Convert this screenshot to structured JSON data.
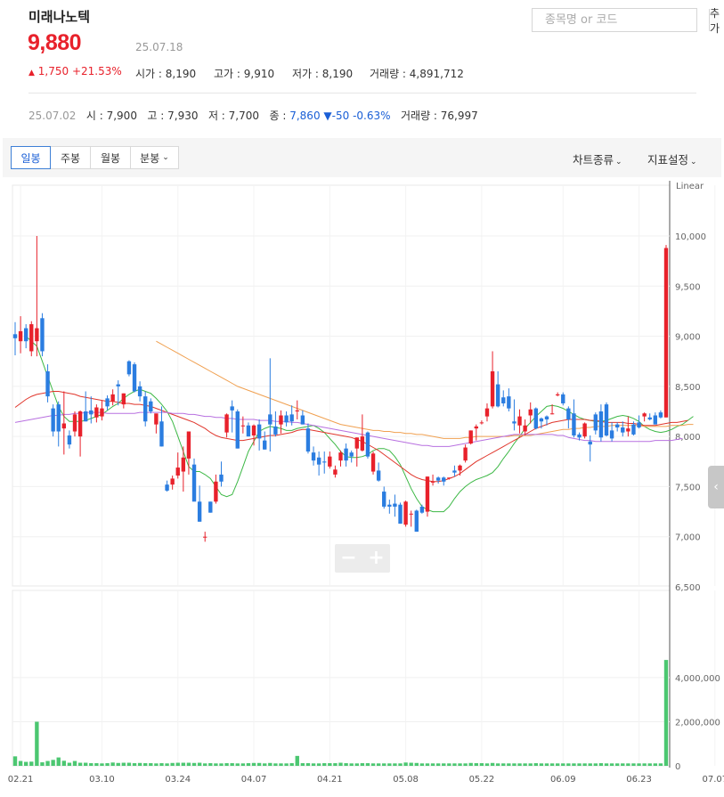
{
  "header": {
    "stock_name": "미래나노텍",
    "search_placeholder": "종목명 or 코드",
    "add_label": "추가",
    "price": "9,880",
    "date": "25.07.18",
    "change_arrow": "▲",
    "change_value": "1,750",
    "change_pct": "+21.53%",
    "open": "시가 : 8,190",
    "high": "고가 : 9,910",
    "low": "저가 : 8,190",
    "volume": "거래량 : 4,891,712"
  },
  "prev": {
    "date": "25.07.02",
    "open": "시 : 7,900",
    "high": "고 : 7,930",
    "low": "저 : 7,700",
    "close_label": "종 :",
    "close_value": "7,860",
    "change_arrow": "▼",
    "change_value": "-50",
    "change_pct": "-0.63%",
    "volume": "거래량 : 76,997"
  },
  "toolbar": {
    "periods": [
      "일봉",
      "주봉",
      "월봉",
      "분봉"
    ],
    "active_period": "일봉",
    "chart_type": "차트종류",
    "indicator": "지표설정"
  },
  "colors": {
    "up": "#e8212b",
    "down": "#2b7de0",
    "volume": "#4cc771",
    "ma5": "#3cb845",
    "ma20": "#e0352b",
    "ma60": "#f0a050",
    "ma120": "#b870e0"
  },
  "chart_data": {
    "type": "candlestick",
    "scale_label": "Linear",
    "y_ticks": [
      "10,000",
      "9,500",
      "9,000",
      "8,500",
      "8,000",
      "7,500",
      "7,000",
      "6,500"
    ],
    "ylim": [
      6500,
      10500
    ],
    "volume_ticks": [
      "4,000,000",
      "2,000,000",
      "0"
    ],
    "volume_ylim": [
      0,
      6500000
    ],
    "x_labels": [
      "02.21",
      "03.10",
      "03.24",
      "04.07",
      "04.21",
      "05.08",
      "05.22",
      "06.09",
      "06.23",
      "07.07"
    ],
    "candles": [
      [
        9020,
        9140,
        8810,
        8980
      ],
      [
        8950,
        9200,
        8830,
        9050
      ],
      [
        9080,
        9120,
        8880,
        8950
      ],
      [
        8850,
        9150,
        8800,
        9120
      ],
      [
        8950,
        10000,
        8800,
        9080
      ],
      [
        9180,
        9230,
        8800,
        8850
      ],
      [
        8650,
        8720,
        8340,
        8400
      ],
      [
        8280,
        8320,
        8000,
        8050
      ],
      [
        8320,
        8350,
        7900,
        8050
      ],
      [
        8080,
        8450,
        7820,
        8130
      ],
      [
        8010,
        8060,
        7880,
        7920
      ],
      [
        8050,
        8250,
        8000,
        8220
      ],
      [
        8000,
        8260,
        7800,
        8250
      ],
      [
        8250,
        8450,
        8150,
        8150
      ],
      [
        8260,
        8400,
        8130,
        8220
      ],
      [
        8190,
        8320,
        8140,
        8290
      ],
      [
        8200,
        8360,
        8160,
        8280
      ],
      [
        8380,
        8410,
        8260,
        8300
      ],
      [
        8350,
        8470,
        8310,
        8420
      ],
      [
        8520,
        8560,
        8310,
        8500
      ],
      [
        8320,
        8430,
        8280,
        8430
      ],
      [
        8750,
        8760,
        8600,
        8620
      ],
      [
        8720,
        8740,
        8440,
        8450
      ],
      [
        8500,
        8550,
        8350,
        8400
      ],
      [
        8400,
        8450,
        8100,
        8150
      ],
      [
        8350,
        8380,
        8230,
        8250
      ],
      [
        8120,
        8220,
        8030,
        8230
      ],
      [
        8150,
        8300,
        7900,
        7900
      ],
      [
        7520,
        7560,
        7450,
        7460
      ],
      [
        7520,
        7610,
        7470,
        7580
      ],
      [
        7610,
        7840,
        7580,
        7690
      ],
      [
        7650,
        7900,
        7450,
        7790
      ],
      [
        7780,
        8050,
        7620,
        8050
      ],
      [
        7720,
        7780,
        7360,
        7350
      ],
      [
        7350,
        7510,
        7150,
        7150
      ],
      [
        7000,
        7050,
        6950,
        7000
      ],
      [
        7350,
        7350,
        7240,
        7240
      ],
      [
        7350,
        7620,
        7330,
        7550
      ],
      [
        7620,
        7750,
        7500,
        7550
      ],
      [
        8040,
        8230,
        7990,
        8220
      ],
      [
        8300,
        8360,
        8040,
        8260
      ],
      [
        8250,
        8270,
        7880,
        7880
      ],
      [
        8110,
        8200,
        8030,
        8110
      ],
      [
        8110,
        8140,
        8000,
        8000
      ],
      [
        8010,
        8120,
        7910,
        8110
      ],
      [
        8120,
        8170,
        7860,
        7980
      ],
      [
        7960,
        8050,
        7870,
        7870
      ],
      [
        8220,
        8780,
        7850,
        8120
      ],
      [
        8100,
        8250,
        8000,
        8020
      ],
      [
        8120,
        8260,
        8030,
        8210
      ],
      [
        8210,
        8250,
        8100,
        8140
      ],
      [
        8220,
        8310,
        8110,
        8150
      ],
      [
        8250,
        8360,
        8170,
        8260
      ],
      [
        8210,
        8260,
        8120,
        8120
      ],
      [
        8080,
        8130,
        7830,
        7850
      ],
      [
        7840,
        7900,
        7710,
        7760
      ],
      [
        7790,
        7850,
        7610,
        7720
      ],
      [
        7750,
        7850,
        7630,
        7740
      ],
      [
        7700,
        7850,
        7680,
        7800
      ],
      [
        7620,
        7710,
        7590,
        7670
      ],
      [
        7760,
        7860,
        7700,
        7840
      ],
      [
        7880,
        7930,
        7700,
        7760
      ],
      [
        7840,
        7860,
        7740,
        7800
      ],
      [
        7880,
        7990,
        7700,
        7990
      ],
      [
        7860,
        8220,
        7850,
        8000
      ],
      [
        8040,
        8050,
        7780,
        7800
      ],
      [
        7650,
        7850,
        7620,
        7830
      ],
      [
        7660,
        7740,
        7550,
        7560
      ],
      [
        7450,
        7500,
        7280,
        7300
      ],
      [
        7320,
        7370,
        7230,
        7300
      ],
      [
        7330,
        7420,
        7200,
        7300
      ],
      [
        7320,
        7340,
        7130,
        7130
      ],
      [
        7120,
        7360,
        7100,
        7350
      ],
      [
        7230,
        7260,
        7100,
        7230
      ],
      [
        7260,
        7270,
        7050,
        7050
      ],
      [
        7300,
        7320,
        7230,
        7240
      ],
      [
        7250,
        7600,
        7200,
        7600
      ],
      [
        7540,
        7620,
        7510,
        7550
      ],
      [
        7590,
        7600,
        7530,
        7560
      ],
      [
        7590,
        7600,
        7510,
        7550
      ],
      [
        7580,
        7590,
        7570,
        7590
      ],
      [
        7660,
        7710,
        7600,
        7640
      ],
      [
        7660,
        7720,
        7610,
        7710
      ],
      [
        7760,
        7920,
        7740,
        7890
      ],
      [
        7930,
        8060,
        7920,
        8060
      ],
      [
        8080,
        8120,
        7960,
        8100
      ],
      [
        8140,
        8160,
        8120,
        8140
      ],
      [
        8200,
        8330,
        8150,
        8280
      ],
      [
        8300,
        8850,
        8280,
        8650
      ],
      [
        8520,
        8650,
        8290,
        8300
      ],
      [
        8390,
        8460,
        8300,
        8330
      ],
      [
        8400,
        8480,
        8250,
        8280
      ],
      [
        8150,
        8370,
        8060,
        8130
      ],
      [
        8110,
        8270,
        8030,
        8200
      ],
      [
        8050,
        8170,
        8010,
        8110
      ],
      [
        8210,
        8340,
        8130,
        8270
      ],
      [
        8280,
        8290,
        8070,
        8080
      ],
      [
        8180,
        8190,
        8080,
        8150
      ],
      [
        8200,
        8210,
        8110,
        8170
      ],
      [
        8230,
        8320,
        8220,
        8230
      ],
      [
        8410,
        8440,
        8400,
        8420
      ],
      [
        8420,
        8440,
        8310,
        8330
      ],
      [
        8280,
        8300,
        8080,
        8170
      ],
      [
        8230,
        8370,
        7990,
        8010
      ],
      [
        8020,
        8040,
        7960,
        7990
      ],
      [
        8000,
        8140,
        7980,
        8130
      ],
      [
        7950,
        8010,
        7750,
        7920
      ],
      [
        8220,
        8240,
        8020,
        8060
      ],
      [
        8250,
        8320,
        7950,
        7990
      ],
      [
        8320,
        8340,
        8000,
        8010
      ],
      [
        8060,
        8140,
        7950,
        7980
      ],
      [
        8120,
        8140,
        8050,
        8090
      ],
      [
        8090,
        8150,
        8000,
        8040
      ],
      [
        8050,
        8200,
        8000,
        8080
      ],
      [
        8120,
        8150,
        8010,
        8020
      ],
      [
        8140,
        8210,
        8080,
        8090
      ],
      [
        8200,
        8240,
        8150,
        8230
      ],
      [
        8190,
        8230,
        8160,
        8170
      ],
      [
        8210,
        8240,
        8120,
        8120
      ],
      [
        8240,
        8260,
        8180,
        8190
      ],
      [
        8190,
        9910,
        8190,
        9880
      ]
    ],
    "volume": [
      430000,
      220000,
      180000,
      190000,
      2000000,
      160000,
      220000,
      270000,
      380000,
      230000,
      140000,
      220000,
      140000,
      140000,
      120000,
      120000,
      110000,
      120000,
      150000,
      130000,
      140000,
      140000,
      120000,
      130000,
      120000,
      120000,
      110000,
      120000,
      110000,
      130000,
      140000,
      140000,
      140000,
      130000,
      140000,
      110000,
      120000,
      110000,
      110000,
      120000,
      120000,
      110000,
      110000,
      120000,
      130000,
      130000,
      110000,
      130000,
      110000,
      110000,
      110000,
      120000,
      450000,
      120000,
      120000,
      110000,
      110000,
      120000,
      120000,
      120000,
      140000,
      120000,
      110000,
      110000,
      120000,
      120000,
      110000,
      110000,
      110000,
      110000,
      110000,
      110000,
      150000,
      140000,
      130000,
      110000,
      110000,
      110000,
      110000,
      110000,
      110000,
      110000,
      110000,
      110000,
      130000,
      120000,
      120000,
      110000,
      130000,
      110000,
      110000,
      110000,
      110000,
      110000,
      110000,
      110000,
      120000,
      110000,
      110000,
      110000,
      110000,
      110000,
      110000,
      110000,
      110000,
      110000,
      110000,
      110000,
      120000,
      110000,
      110000,
      110000,
      110000,
      110000,
      110000,
      110000,
      110000,
      110000,
      110000,
      110000,
      4800000
    ],
    "ma_lines": [
      {
        "key": "ma5",
        "start": 2,
        "values": [
          9000,
          8950,
          8900,
          8750,
          8600,
          8450,
          8300,
          8200,
          8150,
          8150,
          8150,
          8160,
          8180,
          8200,
          8220,
          8260,
          8300,
          8330,
          8380,
          8420,
          8450,
          8470,
          8450,
          8430,
          8380,
          8320,
          8250,
          8150,
          8000,
          7850,
          7700,
          7650,
          7650,
          7620,
          7580,
          7500,
          7420,
          7400,
          7420,
          7550,
          7700,
          7850,
          7950,
          8050,
          8080,
          8100,
          8090,
          8080,
          8060,
          8060,
          8080,
          8090,
          8100,
          8110,
          8080,
          8040,
          7980,
          7920,
          7850,
          7800,
          7790,
          7790,
          7800,
          7820,
          7860,
          7880,
          7880,
          7860,
          7800,
          7720,
          7600,
          7480,
          7380,
          7300,
          7270,
          7250,
          7250,
          7250,
          7300,
          7380,
          7450,
          7500,
          7540,
          7570,
          7590,
          7610,
          7640,
          7700,
          7780,
          7850,
          7930,
          8000,
          8080,
          8140,
          8200,
          8250,
          8300,
          8310,
          8300,
          8280,
          8250,
          8220,
          8190,
          8170,
          8160,
          8150,
          8150,
          8160,
          8180,
          8200,
          8210,
          8200,
          8180,
          8150,
          8100,
          8070,
          8050,
          8040,
          8050,
          8070,
          8100,
          8120,
          8160,
          8200
        ]
      },
      {
        "key": "ma20",
        "start": 0,
        "values": [
          8290,
          8330,
          8370,
          8400,
          8420,
          8430,
          8440,
          8450,
          8450,
          8440,
          8430,
          8420,
          8400,
          8390,
          8380,
          8370,
          8360,
          8350,
          8350,
          8340,
          8330,
          8330,
          8320,
          8320,
          8310,
          8300,
          8280,
          8260,
          8240,
          8220,
          8200,
          8180,
          8160,
          8140,
          8110,
          8080,
          8040,
          8010,
          7990,
          7980,
          7970,
          7960,
          7960,
          7970,
          7980,
          7990,
          8000,
          8010,
          8010,
          8020,
          8030,
          8040,
          8060,
          8070,
          8070,
          8060,
          8050,
          8040,
          8030,
          8020,
          8010,
          8000,
          7990,
          7970,
          7950,
          7920,
          7890,
          7860,
          7820,
          7780,
          7740,
          7700,
          7660,
          7620,
          7590,
          7570,
          7560,
          7550,
          7550,
          7560,
          7580,
          7600,
          7630,
          7670,
          7710,
          7750,
          7780,
          7810,
          7840,
          7870,
          7900,
          7930,
          7960,
          7990,
          8020,
          8050,
          8080,
          8100,
          8120,
          8140,
          8150,
          8160,
          8170,
          8170,
          8170,
          8170,
          8160,
          8160,
          8150,
          8140,
          8140,
          8140,
          8140,
          8130,
          8130,
          8120,
          8110,
          8110,
          8110,
          8120,
          8130,
          8140,
          8140,
          8150,
          8160
        ]
      },
      {
        "key": "ma60",
        "start": 26,
        "values": [
          8950,
          8920,
          8890,
          8860,
          8830,
          8800,
          8770,
          8740,
          8710,
          8680,
          8650,
          8620,
          8590,
          8560,
          8530,
          8500,
          8480,
          8460,
          8440,
          8420,
          8400,
          8380,
          8360,
          8340,
          8320,
          8300,
          8280,
          8260,
          8240,
          8220,
          8200,
          8180,
          8160,
          8140,
          8120,
          8110,
          8100,
          8090,
          8080,
          8070,
          8060,
          8060,
          8050,
          8050,
          8040,
          8040,
          8030,
          8030,
          8020,
          8020,
          8010,
          8000,
          7990,
          7980,
          7980,
          7980,
          7980,
          7990,
          7990,
          8000,
          8000,
          8000,
          8000,
          8000,
          8000,
          8000,
          8010,
          8010,
          8010,
          8010,
          8020,
          8030,
          8040,
          8050,
          8060,
          8070,
          8070,
          8080,
          8080,
          8090,
          8090,
          8100,
          8100,
          8100,
          8110,
          8110,
          8110,
          8110,
          8110,
          8110,
          8100,
          8100,
          8100,
          8100,
          8100,
          8110,
          8110,
          8110,
          8120,
          8120
        ]
      },
      {
        "key": "ma120",
        "start": 0,
        "values": [
          8140,
          8150,
          8160,
          8170,
          8180,
          8190,
          8200,
          8210,
          8210,
          8220,
          8220,
          8230,
          8230,
          8240,
          8240,
          8240,
          8240,
          8230,
          8230,
          8230,
          8230,
          8230,
          8230,
          8240,
          8240,
          8240,
          8240,
          8240,
          8240,
          8230,
          8230,
          8230,
          8220,
          8220,
          8210,
          8200,
          8200,
          8190,
          8190,
          8180,
          8180,
          8170,
          8170,
          8170,
          8170,
          8160,
          8160,
          8160,
          8150,
          8150,
          8150,
          8140,
          8140,
          8130,
          8120,
          8110,
          8100,
          8090,
          8080,
          8070,
          8060,
          8050,
          8040,
          8030,
          8020,
          8010,
          8000,
          7990,
          7980,
          7970,
          7960,
          7950,
          7940,
          7930,
          7920,
          7910,
          7910,
          7900,
          7900,
          7900,
          7900,
          7910,
          7920,
          7930,
          7940,
          7950,
          7960,
          7970,
          7980,
          7990,
          8000,
          8010,
          8020,
          8020,
          8020,
          8020,
          8020,
          8020,
          8020,
          8020,
          8010,
          8010,
          7990,
          7980,
          7970,
          7960,
          7960,
          7950,
          7950,
          7950,
          7950,
          7950,
          7950,
          7950,
          7950,
          7950,
          7950,
          7950,
          7960,
          7960,
          7960,
          7960,
          7970,
          7980
        ]
      }
    ]
  }
}
